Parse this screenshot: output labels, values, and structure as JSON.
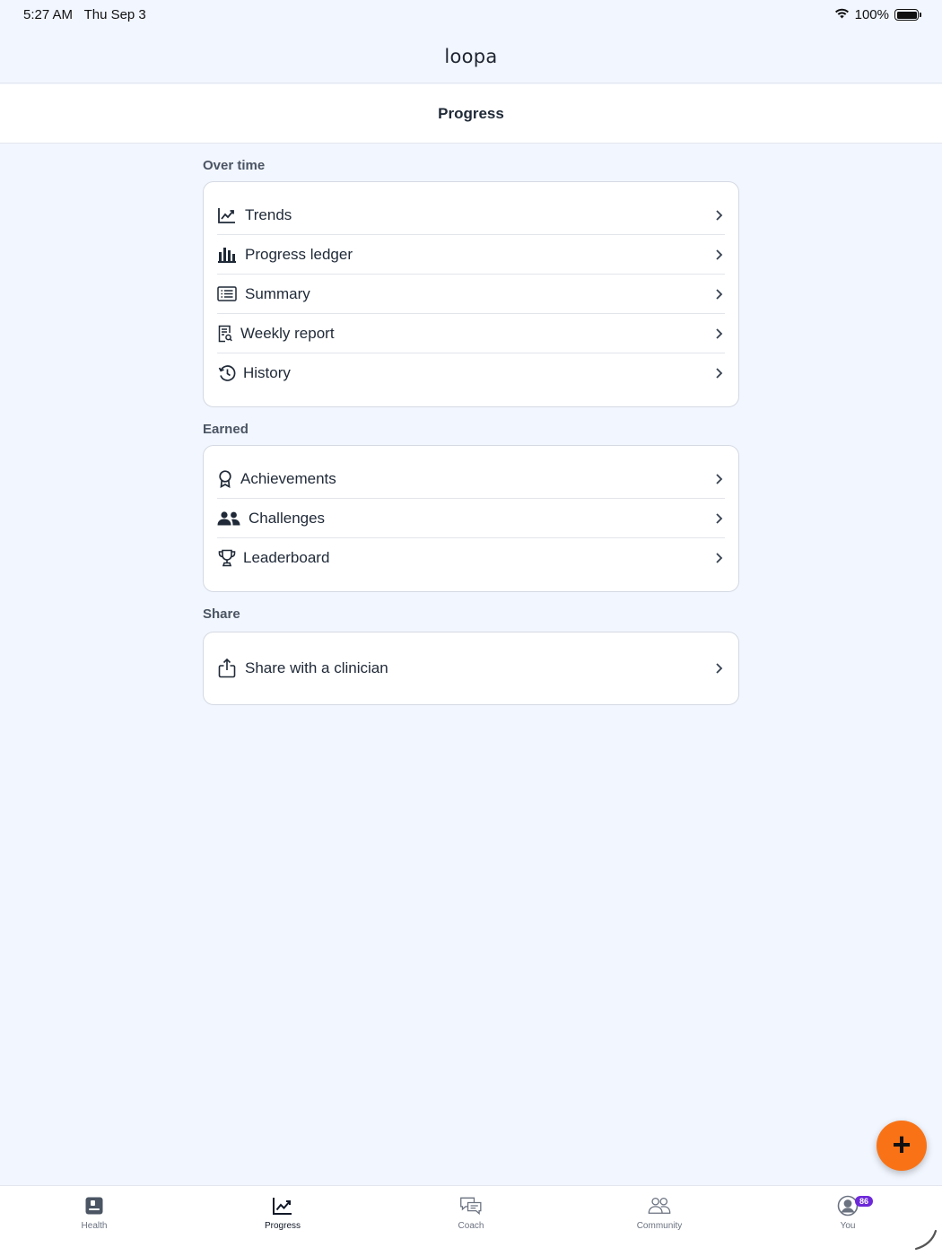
{
  "status": {
    "time": "5:27 AM",
    "date": "Thu Sep 3",
    "battery": "100%"
  },
  "app": {
    "logo": "loopa",
    "title": "Progress"
  },
  "sections": [
    {
      "label": "Over time",
      "items": [
        {
          "label": "Trends",
          "icon": "trend-chart-icon"
        },
        {
          "label": "Progress ledger",
          "icon": "bar-chart-icon"
        },
        {
          "label": "Summary",
          "icon": "list-icon"
        },
        {
          "label": "Weekly report",
          "icon": "report-icon"
        },
        {
          "label": "History",
          "icon": "history-icon"
        }
      ]
    },
    {
      "label": "Earned",
      "items": [
        {
          "label": "Achievements",
          "icon": "award-icon"
        },
        {
          "label": "Challenges",
          "icon": "people-icon"
        },
        {
          "label": "Leaderboard",
          "icon": "trophy-icon"
        }
      ]
    },
    {
      "label": "Share",
      "items": [
        {
          "label": "Share with a clinician",
          "icon": "share-icon"
        }
      ]
    }
  ],
  "tabs": [
    {
      "label": "Health",
      "icon": "health-icon",
      "active": false
    },
    {
      "label": "Progress",
      "icon": "progress-icon",
      "active": true
    },
    {
      "label": "Coach",
      "icon": "chat-icon",
      "active": false
    },
    {
      "label": "Community",
      "icon": "community-icon",
      "active": false
    },
    {
      "label": "You",
      "icon": "profile-icon",
      "active": false,
      "badge": "86"
    }
  ],
  "colors": {
    "accent": "#f97316",
    "badge": "#6d28d9",
    "background": "#f2f6fe"
  }
}
